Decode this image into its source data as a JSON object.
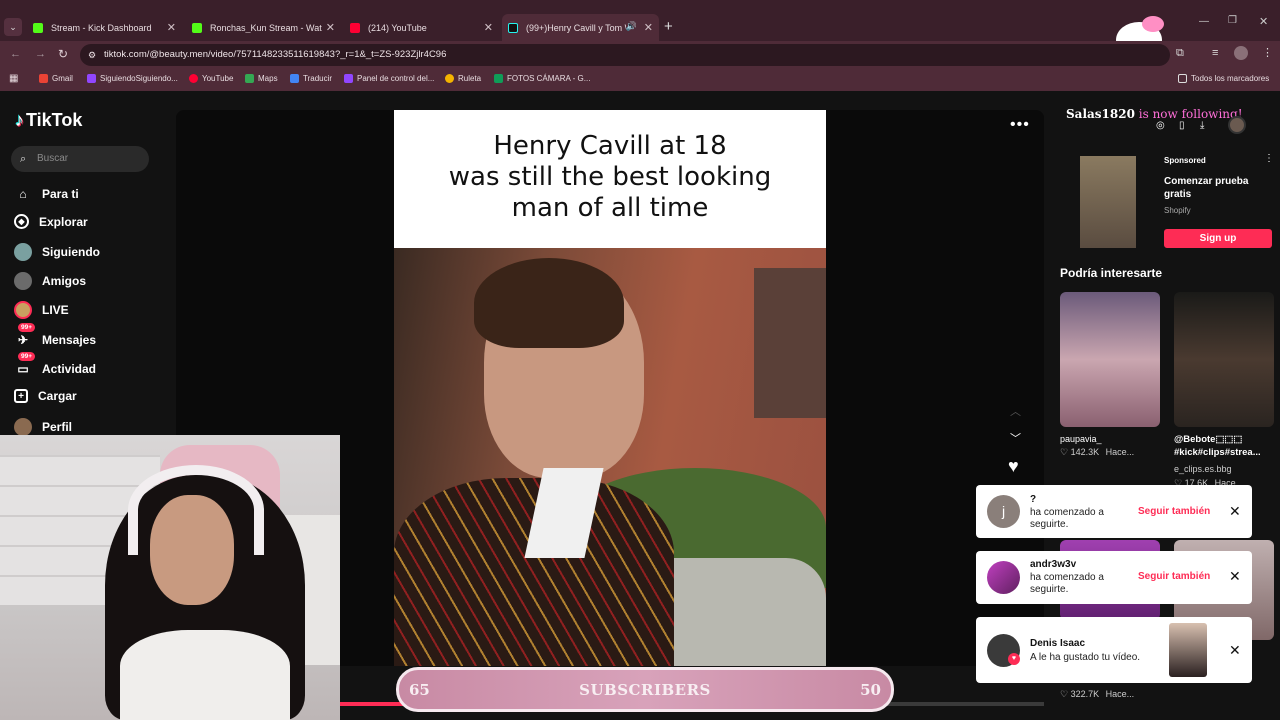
{
  "browser": {
    "tabs": [
      {
        "label": "Stream - Kick Dashboard",
        "icon": "kick-icon"
      },
      {
        "label": "Ronchas_Kun Stream - Watch L",
        "icon": "kick-icon"
      },
      {
        "label": "(214) YouTube",
        "icon": "youtube-icon"
      },
      {
        "label": "(99+)Henry Cavill y Tom W",
        "icon": "tiktok-icon"
      }
    ],
    "url": "tiktok.com/@beauty.men/video/7571148233511619843?_r=1&_t=ZS-923Zjlr4C96",
    "bookmarks": [
      "Gmail",
      "SiguiendoSiguiendo...",
      "YouTube",
      "Maps",
      "Traducir",
      "Panel de control del...",
      "Ruleta",
      "FOTOS CÁMARA - G..."
    ],
    "all_bookmarks": "Todos los marcadores"
  },
  "tiktok": {
    "logo": "TikTok",
    "search_placeholder": "Buscar",
    "nav": [
      {
        "label": "Para ti",
        "icon": "home-icon"
      },
      {
        "label": "Explorar",
        "icon": "compass-icon"
      },
      {
        "label": "Siguiendo",
        "icon": "following-avatar-icon"
      },
      {
        "label": "Amigos",
        "icon": "friends-icon"
      },
      {
        "label": "LIVE",
        "icon": "live-icon"
      },
      {
        "label": "Mensajes",
        "icon": "messages-icon",
        "badge": "99+"
      },
      {
        "label": "Actividad",
        "icon": "activity-icon",
        "badge": "99+"
      },
      {
        "label": "Cargar",
        "icon": "upload-icon"
      },
      {
        "label": "Perfil",
        "icon": "profile-icon"
      }
    ],
    "video_caption": [
      "Henry Cavill at 18",
      "was still the best looking",
      "man of all time"
    ],
    "sponsored": {
      "tag": "Sponsored",
      "title": "Comenzar prueba gratis",
      "brand": "Shopify",
      "cta": "Sign up"
    },
    "suggest_title": "Podría interesarte",
    "suggestions": [
      {
        "user": "paupavia_",
        "views": "142.3K",
        "time": "Hace..."
      },
      {
        "user": "@Bebote⬚⬚⬚ #kick#clips#strea...",
        "sub": "e_clips.es.bbg",
        "views": "17.6K",
        "time": "Hace..."
      }
    ],
    "bottom_views": "322.7K",
    "bottom_time": "Hace..."
  },
  "overlay": {
    "follow_user": "Salas1820",
    "follow_text": "is now following!"
  },
  "notifications": [
    {
      "name": "?",
      "text": "ha comenzado a seguirte.",
      "action": "Seguir también",
      "avatar_letter": "j"
    },
    {
      "name": "andr3w3v",
      "text": "ha comenzado a seguirte.",
      "action": "Seguir también"
    },
    {
      "name": "Denis Isaac",
      "text": "A le ha gustado tu vídeo."
    }
  ],
  "subscribers": {
    "left": "65",
    "label": "SUBSCRIBERS",
    "right": "50",
    "progress": 0.13
  }
}
